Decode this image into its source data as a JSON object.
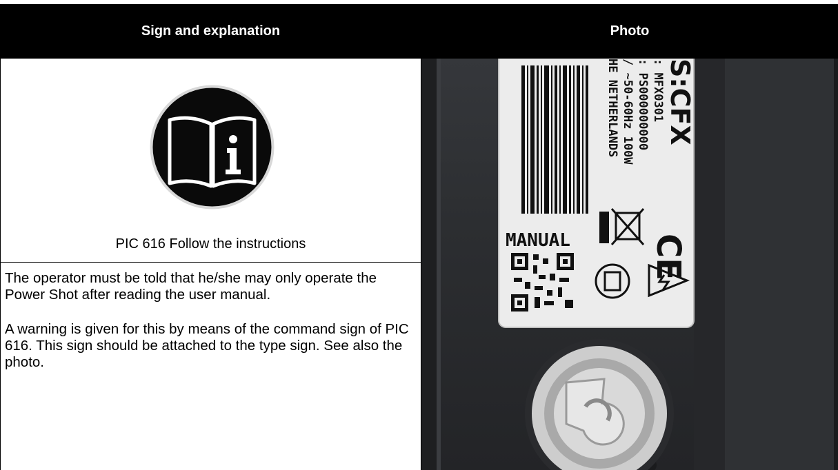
{
  "table": {
    "col_headers": [
      "Sign and explanation",
      "Photo"
    ]
  },
  "sign": {
    "icon": "manual-info-icon",
    "caption": "PIC 616 Follow the instructions"
  },
  "explanation": {
    "paragraphs": [
      "The operator must be told that he/she may only operate the Power Shot after reading the user manual.",
      "A warning is given for this by means of the command sign of PIC 616. This sign should be attached to the type sign. See also the photo."
    ]
  },
  "photo": {
    "label_lines": [
      ": MFX0301",
      ": PS000000000",
      "/ ~50-60Hz 100W",
      "HE NETHERLANDS"
    ],
    "brand": "S:CFX",
    "manual_label": "MANUAL",
    "ce_mark": "CE"
  },
  "colors": {
    "header_bg": "#000000",
    "header_text": "#ffffff",
    "photo_bg": "#2c2e31"
  }
}
